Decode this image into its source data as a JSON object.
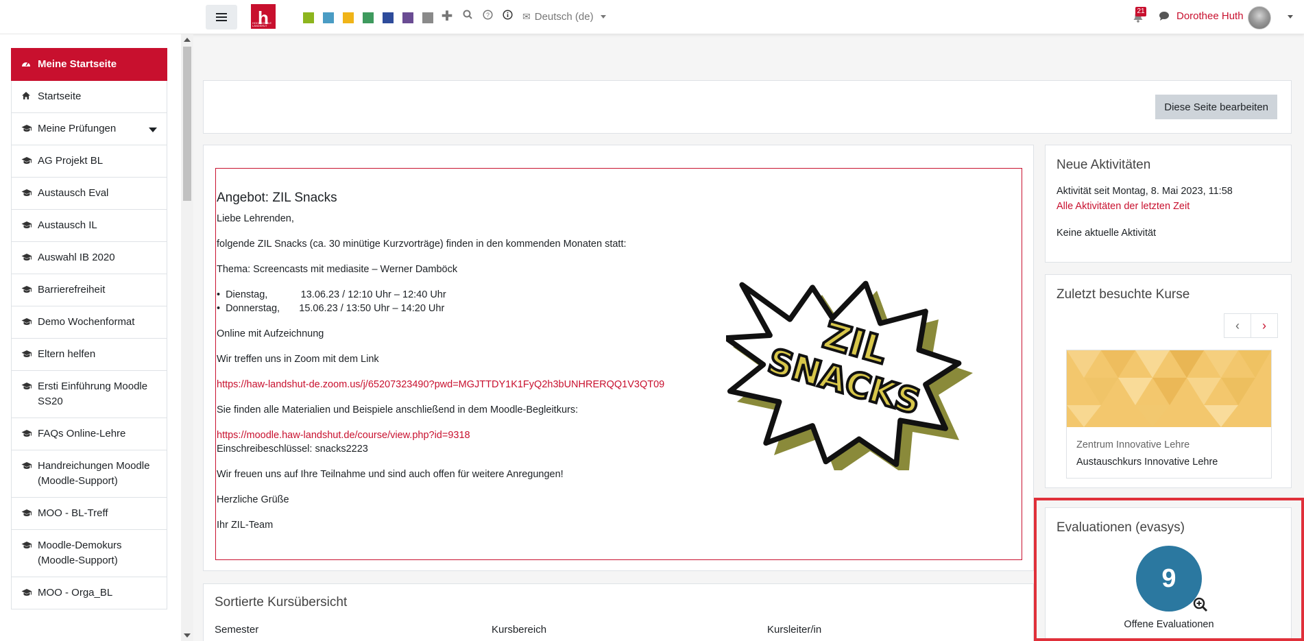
{
  "navbar": {
    "swatch_colors": [
      "#8db51e",
      "#4a9cc4",
      "#f0b418",
      "#3e9a5e",
      "#2e4c9b",
      "#6a4c93",
      "#8a8a8a"
    ],
    "language": "Deutsch (de)",
    "notification_count": "21",
    "user_name": "Dorothee Huth"
  },
  "sidebar": {
    "items": [
      {
        "label": "Meine Startseite",
        "icon": "dashboard-icon"
      },
      {
        "label": "Startseite",
        "icon": "home-icon"
      },
      {
        "label": "Meine Prüfungen",
        "icon": "graduation-cap-icon"
      },
      {
        "label": "AG Projekt BL",
        "icon": "graduation-cap-icon"
      },
      {
        "label": "Austausch Eval",
        "icon": "graduation-cap-icon"
      },
      {
        "label": "Austausch IL",
        "icon": "graduation-cap-icon"
      },
      {
        "label": "Auswahl IB 2020",
        "icon": "graduation-cap-icon"
      },
      {
        "label": "Barrierefreiheit",
        "icon": "graduation-cap-icon"
      },
      {
        "label": "Demo Wochenformat",
        "icon": "graduation-cap-icon"
      },
      {
        "label": "Eltern helfen",
        "icon": "graduation-cap-icon"
      },
      {
        "label": "Ersti Einführung Moodle SS20",
        "icon": "graduation-cap-icon"
      },
      {
        "label": "FAQs Online-Lehre",
        "icon": "graduation-cap-icon"
      },
      {
        "label": "Handreichungen Moodle (Moodle-Support)",
        "icon": "graduation-cap-icon"
      },
      {
        "label": "MOO - BL-Treff",
        "icon": "graduation-cap-icon"
      },
      {
        "label": "Moodle-Demokurs (Moodle-Support)",
        "icon": "graduation-cap-icon"
      },
      {
        "label": "MOO - Orga_BL",
        "icon": "graduation-cap-icon"
      }
    ]
  },
  "main": {
    "edit_button": "Diese Seite bearbeiten",
    "announcement": {
      "title": "Angebot: ZIL Snacks",
      "greeting": "Liebe Lehrenden,",
      "intro": "folgende ZIL Snacks (ca. 30 minütige Kurzvorträge) finden in den kommenden Monaten statt:",
      "topic": "Thema: Screencasts mit mediasite – Werner Damböck",
      "dates": [
        "Dienstag,            13.06.23 / 12:10 Uhr – 12:40 Uhr",
        "Donnerstag,       15.06.23 / 13:50 Uhr – 14:20 Uhr"
      ],
      "recording": "Online mit Aufzeichnung",
      "zoom_intro": "Wir treffen uns in Zoom mit dem Link",
      "zoom_link": "https://haw-landshut-de.zoom.us/j/65207323490?pwd=MGJTTDY1K1FyQ2h3bUNHRERQQ1V3QT09",
      "materials": "Sie finden alle Materialien und Beispiele anschließend in dem Moodle-Begleitkurs:",
      "course_link": "https://moodle.haw-landshut.de/course/view.php?id=9318",
      "enrol_key": "Einschreibeschlüssel: snacks2223",
      "closing": "Wir freuen uns auf Ihre Teilnahme und sind auch offen für weitere Anregungen!",
      "regards": "Herzliche Grüße",
      "signature": "Ihr ZIL-Team",
      "image_text_line1": "ZIL",
      "image_text_line2": "SNACKS"
    },
    "sorted_overview": {
      "title": "Sortierte Kursübersicht",
      "columns": [
        "Semester",
        "Kursbereich",
        "Kursleiter/in"
      ]
    }
  },
  "right": {
    "activities": {
      "title": "Neue Aktivitäten",
      "since": "Aktivität seit Montag, 8. Mai 2023, 11:58",
      "link": "Alle Aktivitäten der letzten Zeit",
      "none": "Keine aktuelle Aktivität"
    },
    "recent_courses": {
      "title": "Zuletzt besuchte Kurse",
      "category": "Zentrum Innovative Lehre",
      "course": "Austauschkurs Innovative Lehre"
    },
    "evaluations": {
      "title": "Evaluationen (evasys)",
      "count": "9",
      "label": "Offene Evaluationen"
    }
  }
}
